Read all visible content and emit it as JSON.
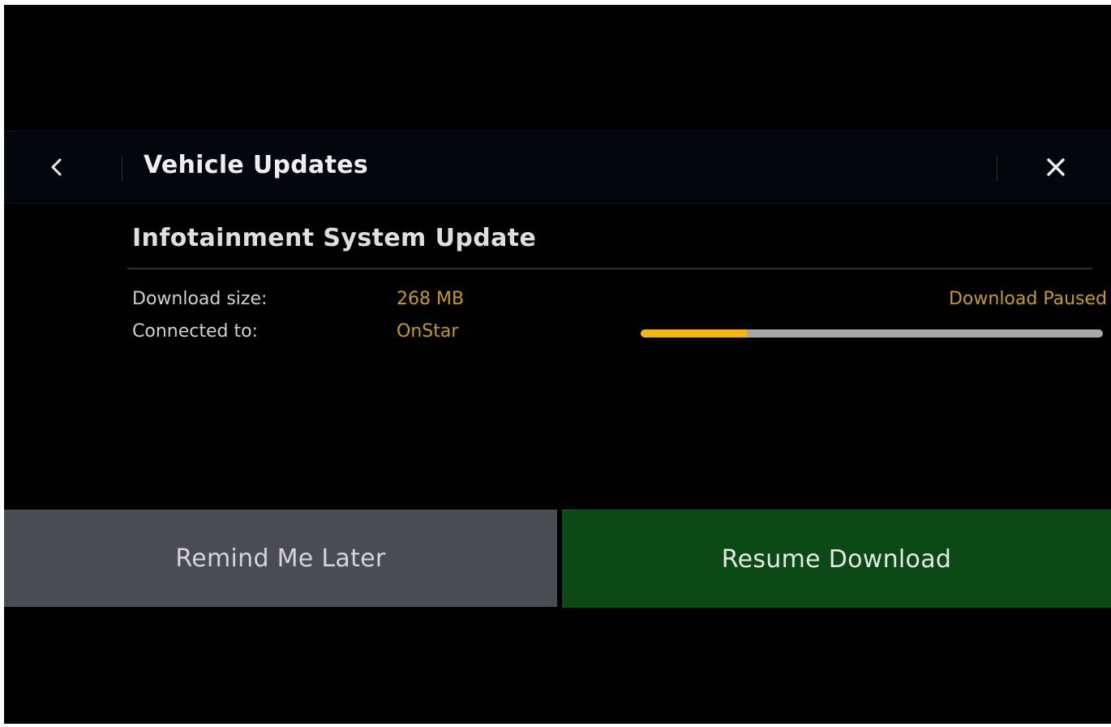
{
  "header": {
    "title": "Vehicle Updates",
    "back_icon": "chevron-left-icon",
    "close_icon": "close-icon"
  },
  "update": {
    "title": "Infotainment System Update",
    "download_size_label": "Download size:",
    "download_size_value": "268 MB",
    "connected_label": "Connected to:",
    "connected_value": "OnStar",
    "status": "Download Paused",
    "progress_fraction": 0.23
  },
  "actions": {
    "remind_label": "Remind Me Later",
    "resume_label": "Resume Download"
  },
  "colors": {
    "accent": "#c69a28",
    "progress_fill": "#f2b80e",
    "progress_track": "#a8a8aa",
    "primary_button": "#0b4a14",
    "secondary_button": "#4a4c53",
    "background": "#010102"
  }
}
